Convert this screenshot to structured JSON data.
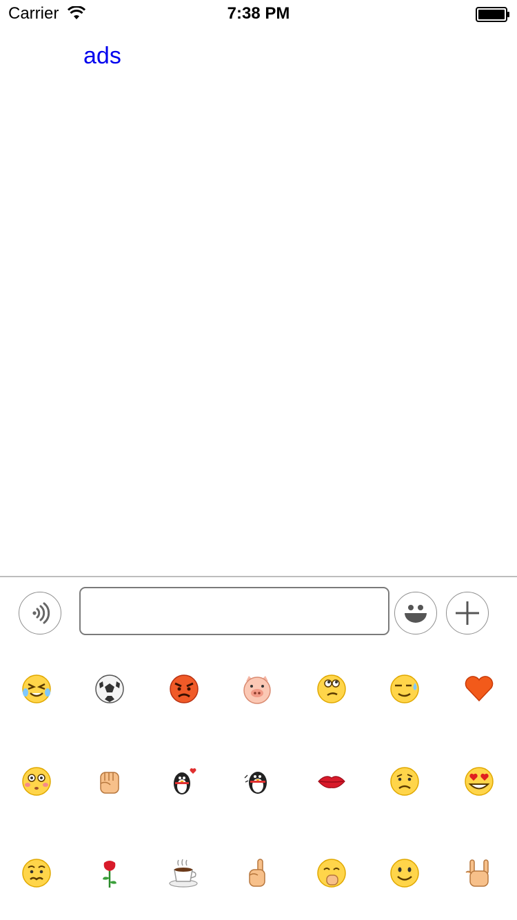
{
  "status_bar": {
    "carrier": "Carrier",
    "time": "7:38 PM"
  },
  "content": {
    "link_text": "ads",
    "link_color": "#0000ee"
  },
  "input_bar": {
    "text_value": "",
    "voice_icon": "voice-icon",
    "emoji_icon": "smiley-icon",
    "plus_icon": "plus-icon"
  },
  "emoji_panel": {
    "rows": [
      [
        "crying-laugh-face",
        "soccer-ball",
        "angry-face",
        "pig-face",
        "thinking-face",
        "sweat-face",
        "heart"
      ],
      [
        "blushing-face",
        "fist",
        "penguin-heart",
        "penguin-dance",
        "lips",
        "sad-face",
        "heart-eyes-face"
      ],
      [
        "worried-face",
        "rose",
        "coffee-cup",
        "pointing-hand",
        "shy-face",
        "smiling-face",
        "rock-hand"
      ]
    ]
  }
}
